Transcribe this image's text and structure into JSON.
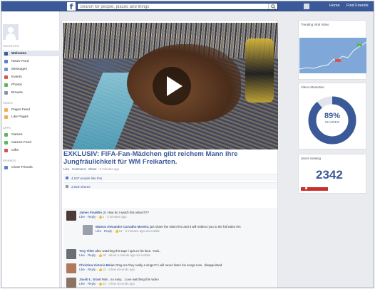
{
  "topbar": {
    "search_placeholder": "Search for people, places and things",
    "home_label": "Home",
    "friends_label": "Find Friends"
  },
  "sidebar": {
    "sections": [
      {
        "label": "FAVORITES",
        "items": [
          {
            "label": "Welcome",
            "icon": "welcome-icon",
            "color": "#3b5998",
            "active": true
          },
          {
            "label": "News Feed",
            "icon": "news-feed-icon",
            "color": "#5b7bd5"
          },
          {
            "label": "Messages",
            "icon": "messages-icon",
            "color": "#6f8fd8"
          },
          {
            "label": "Events",
            "icon": "events-icon",
            "color": "#d9534f"
          },
          {
            "label": "Photos",
            "icon": "photos-icon",
            "color": "#5cb85c"
          },
          {
            "label": "Browse",
            "icon": "browse-icon",
            "color": "#8a93a6"
          }
        ]
      },
      {
        "label": "PAGES",
        "items": [
          {
            "label": "Pages Feed",
            "icon": "pages-feed-icon",
            "color": "#f0ad4e"
          },
          {
            "label": "Like Pages",
            "icon": "like-pages-icon",
            "color": "#f0ad4e"
          }
        ]
      },
      {
        "label": "APPS",
        "items": [
          {
            "label": "Games",
            "icon": "games-icon",
            "color": "#5cb85c"
          },
          {
            "label": "Games Feed",
            "icon": "games-feed-icon",
            "color": "#5cb85c"
          },
          {
            "label": "Gifts",
            "icon": "gifts-icon",
            "color": "#d9534f"
          }
        ]
      },
      {
        "label": "FRIENDS",
        "items": [
          {
            "label": "Close Friends",
            "icon": "close-friends-icon",
            "color": "#5b7bd5"
          }
        ]
      }
    ]
  },
  "post": {
    "title_line1": "EXKLUSIV: FIFA-Fan-Mädchen gibt reichem Mann ihre",
    "title_line2": "Jungfräulichkeit für WM Freikarten.",
    "meta": {
      "like": "Like",
      "comment": "Comment",
      "share": "Share",
      "time": "3 minutes ago"
    },
    "likes": "4,647 people like this.",
    "shares": "3,620 shares"
  },
  "comments": [
    {
      "name": "James Franklin Jr.",
      "text": "How do I watch this video!!!??",
      "actions": "Like · Reply ·",
      "likes": "2",
      "time": "3 minutes ago",
      "avatar_color": "#4a3b36"
    },
    {
      "name": "Mateus Alexandre Carvalho Moreira",
      "text": "just share the video first and it will redirect you to the full video hrs",
      "actions": "Like · Reply ·",
      "likes": "14",
      "time": "3 minutes ago via mobile",
      "avatar_color": "#9aa0aa",
      "reply": true
    },
    {
      "name": "Troy Titler",
      "text": "after watching this tape i spit on his face. Yuck..",
      "actions": "Like · Reply ·",
      "likes": "16",
      "time": "about a minute ago via mobile",
      "avatar_color": "#6b6e73"
    },
    {
      "name": "Christina-Victoria Belan",
      "text": "Omg are they really a singer?! i will never listen his songs now.. disappointed",
      "actions": "Like · Reply ·",
      "likes": "13",
      "time": "a few seconds ago",
      "avatar_color": "#b07a5a"
    },
    {
      "name": "Jacob L. Grant",
      "text": "Man.. so easy... Love watching this video",
      "actions": "Like · Reply ·",
      "likes": "23",
      "time": "a few seconds ago",
      "avatar_color": "#8c7260"
    }
  ],
  "right": {
    "trending_title": "Trending Viral Video",
    "interaction_title": "Video Interaction",
    "donut_percent": "89%",
    "donut_sub": "SHARES",
    "donut_fraction": 0.89,
    "viewing_title": "Users Viewing",
    "viewing_count": "2342",
    "accent": "#3b5998"
  }
}
